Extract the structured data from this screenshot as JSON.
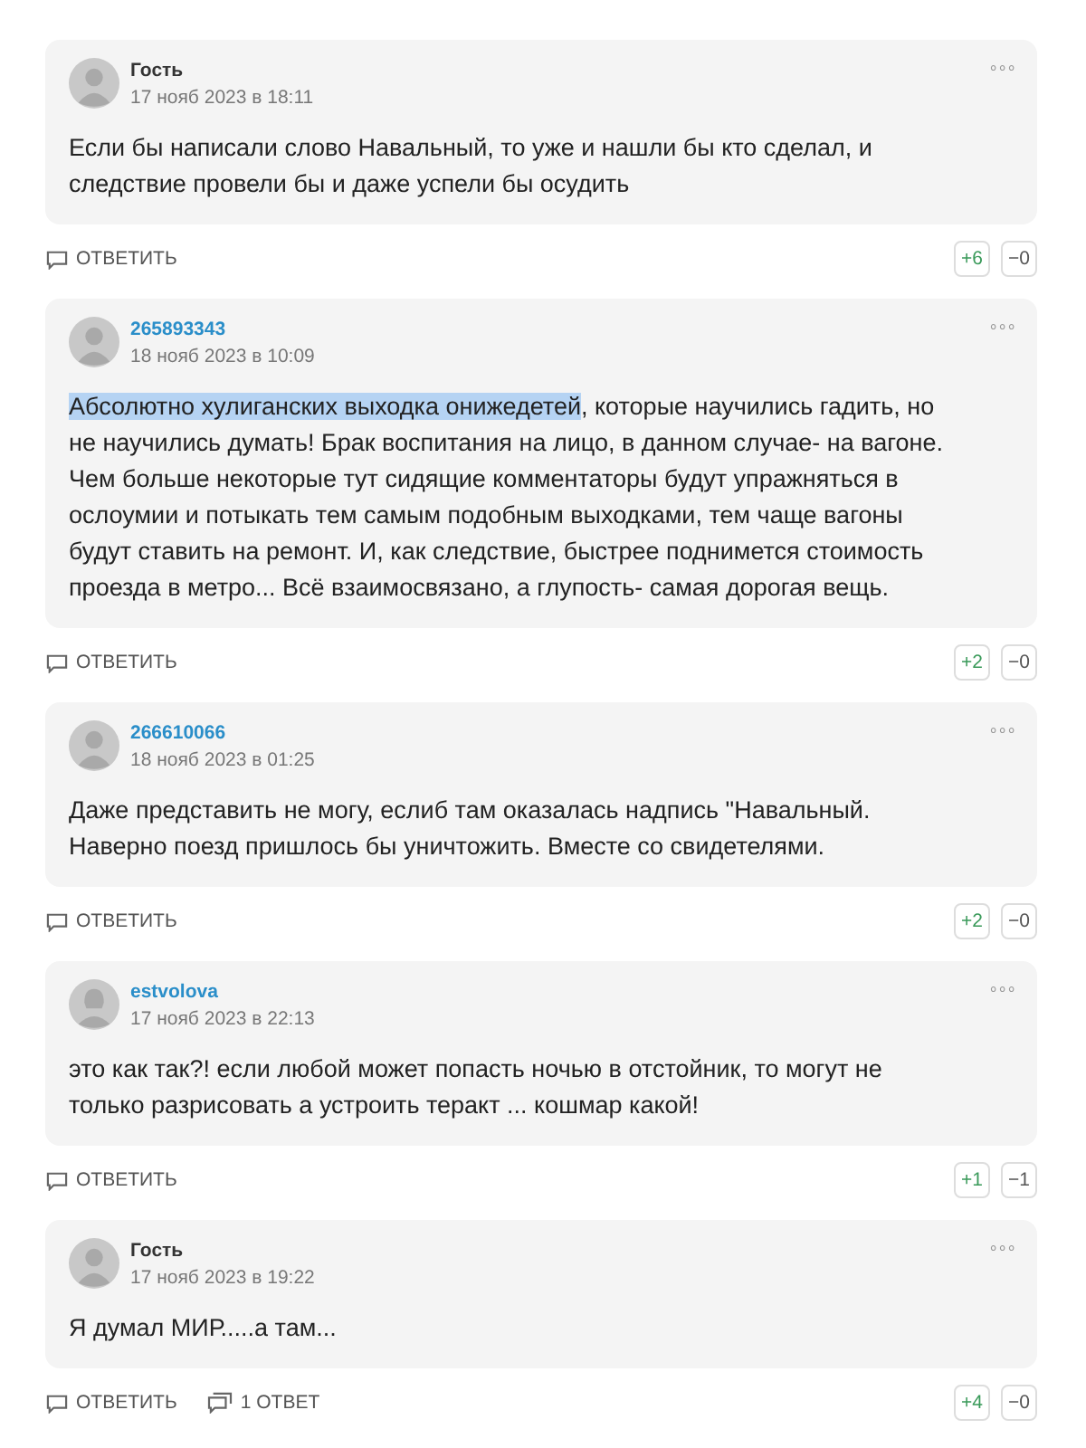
{
  "comments": [
    {
      "author": "Гость",
      "registered": false,
      "female_avatar": false,
      "date": "17 нояб 2023 в 18:11",
      "menu": "∘∘∘",
      "text": "Если бы написали слово Навальный, то уже и нашли бы кто сделал, и следствие провели бы и даже успели бы осудить",
      "reply": "ОТВЕТИТЬ",
      "plus": "+6",
      "minus": "−0"
    },
    {
      "author": "265893343",
      "registered": true,
      "female_avatar": false,
      "date": "18 нояб 2023 в 10:09",
      "menu": "∘∘∘",
      "highlighted_text": "Абсолютно хулиганских выходка онижедетей",
      "text": ", которые научились гадить, но не научились думать! Брак воспитания на лицо, в данном случае- на вагоне. Чем больше некоторые тут сидящие комментаторы будут упражняться в ослоумии и потыкать тем самым подобным выходками, тем чаще вагоны будут ставить на ремонт. И, как следствие, быстрее поднимется стоимость проезда в метро... Всё взаимосвязано, а глупость- самая дорогая вещь.",
      "reply": "ОТВЕТИТЬ",
      "plus": "+2",
      "minus": "−0"
    },
    {
      "author": "266610066",
      "registered": true,
      "female_avatar": false,
      "date": "18 нояб 2023 в 01:25",
      "menu": "∘∘∘",
      "text": "Даже представить не могу, еслиб там оказалась надпись \"Навальный. Наверно поезд пришлось бы уничтожить. Вместе со свидетелями.",
      "reply": "ОТВЕТИТЬ",
      "plus": "+2",
      "minus": "−0"
    },
    {
      "author": "estvolova",
      "registered": true,
      "female_avatar": true,
      "date": "17 нояб 2023 в 22:13",
      "menu": "∘∘∘",
      "text": "это как так?! если любой может попасть ночью в отстойник, то могут не только разрисовать а устроить теракт ... кошмар какой!",
      "reply": "ОТВЕТИТЬ",
      "plus": "+1",
      "minus": "−1"
    },
    {
      "author": "Гость",
      "registered": false,
      "female_avatar": false,
      "date": "17 нояб 2023 в 19:22",
      "menu": "∘∘∘",
      "text": "Я думал МИР.....а там...",
      "reply": "ОТВЕТИТЬ",
      "replies": "1 ОТВЕТ",
      "plus": "+4",
      "minus": "−0"
    }
  ]
}
